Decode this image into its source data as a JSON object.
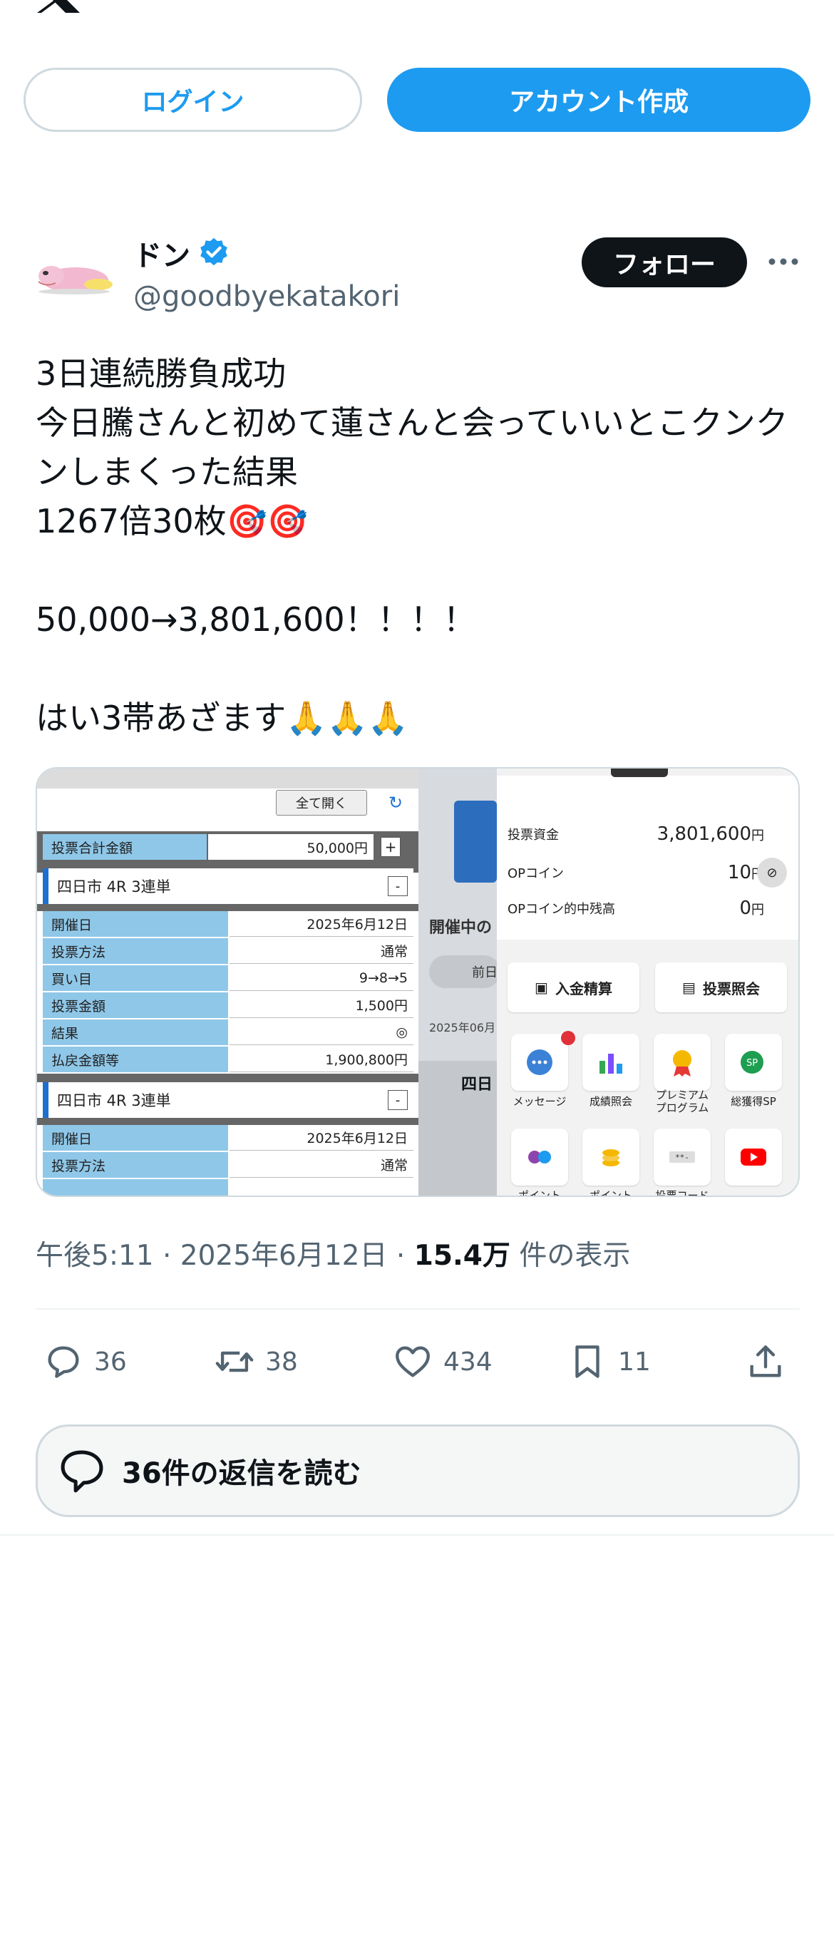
{
  "auth": {
    "login_label": "ログイン",
    "signup_label": "アカウント作成"
  },
  "author": {
    "display_name": "ドン",
    "handle": "@goodbyekatakori",
    "follow_label": "フォロー"
  },
  "tweet": {
    "text": "3日連続勝負成功\n今日騰さんと初めて蓮さんと会っていいとこクンクンしまくった結果\n1267倍30枚🎯🎯\n\n50,000→3,801,600！！！！\n\nはい3帯あざます🙏🙏🙏"
  },
  "media": {
    "left": {
      "open_all": "全て開く",
      "total_label": "投票合計金額",
      "total_value": "50,000円",
      "section1_title": "四日市 4R 3連単",
      "rows": [
        {
          "label": "開催日",
          "value": "2025年6月12日"
        },
        {
          "label": "投票方法",
          "value": "通常"
        },
        {
          "label": "買い目",
          "value": "9→8→5"
        },
        {
          "label": "投票金額",
          "value": "1,500円"
        },
        {
          "label": "結果",
          "value": "◎"
        },
        {
          "label": "払戻金額等",
          "value": "1,900,800円"
        }
      ],
      "section2_title": "四日市 4R 3連単",
      "rows2": [
        {
          "label": "開催日",
          "value": "2025年6月12日"
        },
        {
          "label": "投票方法",
          "value": "通常"
        }
      ]
    },
    "middle": {
      "title": "開催中の",
      "pill": "前日",
      "date": "2025年06月",
      "venue": "四日"
    },
    "right": {
      "balance_label": "投票資金",
      "balance_value": "3,801,600",
      "balance_unit": "円",
      "op_label": "OPコイン",
      "op_value": "10",
      "op_unit": "円",
      "op_hit_label": "OPコイン的中残高",
      "op_hit_value": "0",
      "op_hit_unit": "円",
      "deposit_label": "入金精算",
      "vote_inquiry_label": "投票照会",
      "tiles": [
        {
          "label": "メッセージ"
        },
        {
          "label": "成績照会"
        },
        {
          "label": "プレミアム\nプログラム"
        },
        {
          "label": "総獲得SP"
        },
        {
          "label": "ポイント"
        },
        {
          "label": "ポイント"
        },
        {
          "label": "投票コード"
        }
      ]
    }
  },
  "meta": {
    "time": "午後5:11",
    "date": "2025年6月12日",
    "views": "15.4万",
    "views_suffix": "件の表示"
  },
  "actions": {
    "replies": "36",
    "reposts": "38",
    "likes": "434",
    "bookmarks": "11"
  },
  "read_replies_label": "36件の返信を読む",
  "colors": {
    "accent": "#1d9bf0",
    "text": "#0f1419",
    "muted": "#536471"
  }
}
